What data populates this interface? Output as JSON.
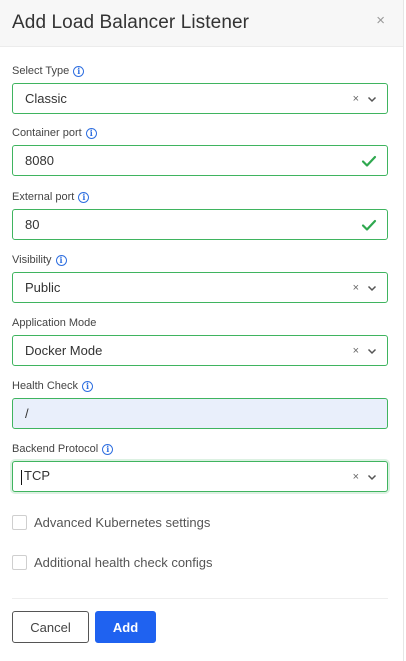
{
  "modal": {
    "title": "Add Load Balancer Listener",
    "close_glyph": "×"
  },
  "fields": {
    "select_type": {
      "label": "Select Type",
      "value": "Classic",
      "has_info": true
    },
    "container_port": {
      "label": "Container port",
      "value": "8080",
      "has_info": true
    },
    "external_port": {
      "label": "External port",
      "value": "80",
      "has_info": true
    },
    "visibility": {
      "label": "Visibility",
      "value": "Public",
      "has_info": true
    },
    "application_mode": {
      "label": "Application Mode",
      "value": "Docker Mode",
      "has_info": false
    },
    "health_check": {
      "label": "Health Check",
      "value": "/",
      "has_info": true
    },
    "backend_protocol": {
      "label": "Backend Protocol",
      "value": "TCP",
      "has_info": true
    }
  },
  "checkboxes": {
    "advanced_kubernetes": {
      "label": "Advanced Kubernetes settings",
      "checked": false
    },
    "additional_health": {
      "label": "Additional health check configs",
      "checked": false
    }
  },
  "buttons": {
    "cancel": "Cancel",
    "add": "Add"
  },
  "select_controls": {
    "clear_glyph": "×"
  },
  "info_glyph": "i",
  "colors": {
    "valid_border": "#3fb45f",
    "primary": "#1f62f0",
    "info": "#2f6fe0",
    "readonly_bg": "#e9effb"
  },
  "icons": [
    "close-icon",
    "info-icon",
    "checkmark-icon",
    "clear-icon",
    "chevron-down-icon"
  ]
}
